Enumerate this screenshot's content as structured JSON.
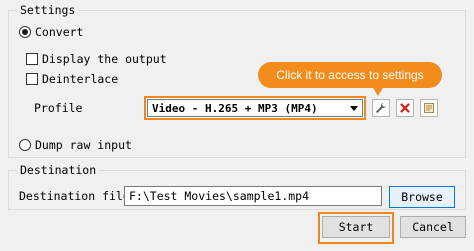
{
  "settings": {
    "title": "Settings",
    "convert_label": "Convert",
    "display_output_label": "Display the output",
    "deinterlace_label": "Deinterlace",
    "profile_label": "Profile",
    "profile_value": "Video - H.265 + MP3 (MP4)",
    "dump_raw_label": "Dump raw input",
    "convert_selected": true,
    "display_output_checked": false,
    "deinterlace_checked": false
  },
  "callout": {
    "text": "Click it to access to settings",
    "color": "#f28c1d"
  },
  "profile_tools": {
    "edit_icon": "wrench-icon",
    "delete_icon": "red-x-icon",
    "new_icon": "new-profile-icon"
  },
  "destination": {
    "title": "Destination",
    "file_label": "Destination file:",
    "file_value": "F:\\Test Movies\\sample1.mp4",
    "browse_label": "Browse"
  },
  "footer": {
    "start_label": "Start",
    "cancel_label": "Cancel"
  },
  "highlight_color": "#f0871e"
}
